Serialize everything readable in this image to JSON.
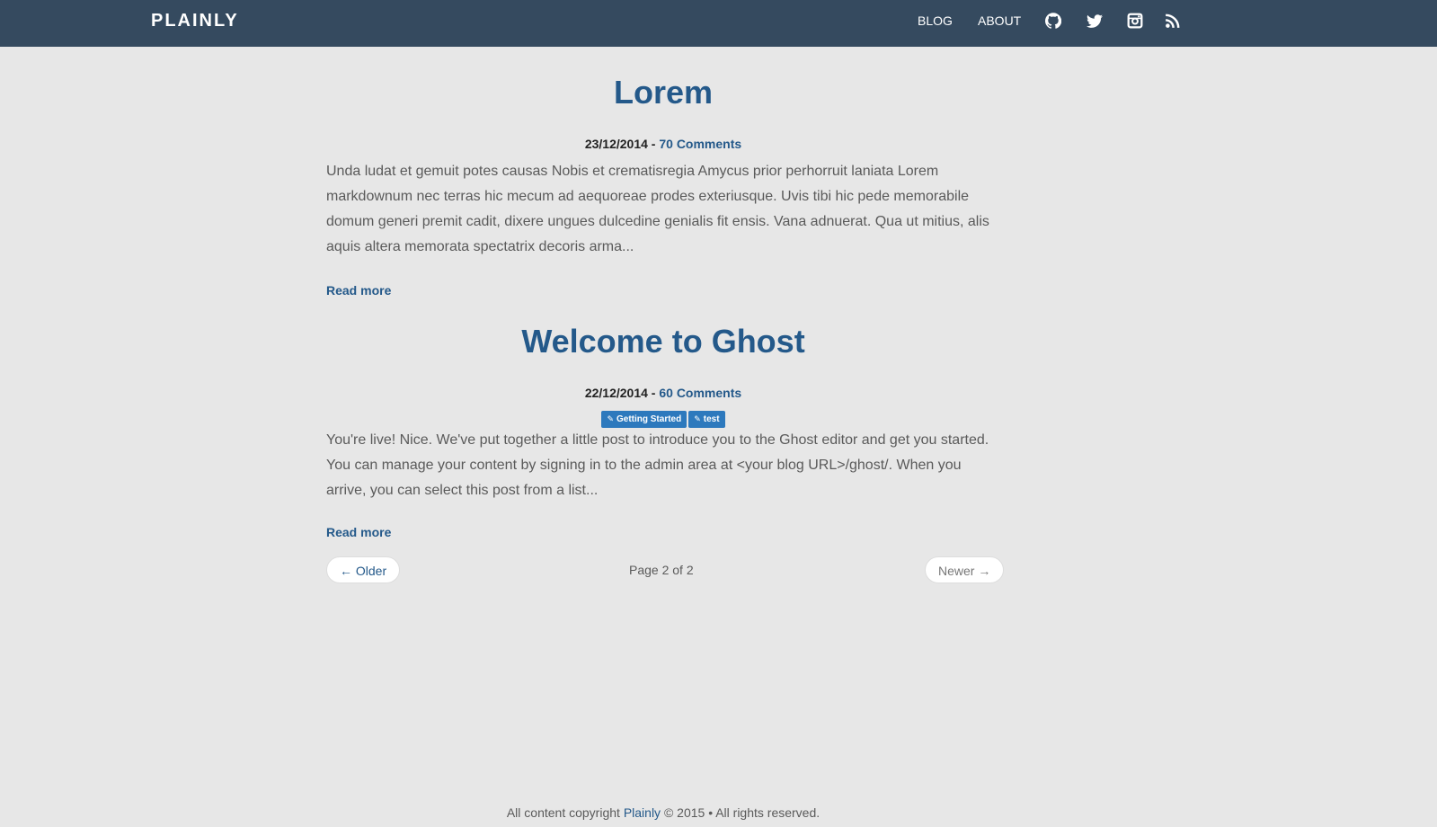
{
  "nav": {
    "brand": "PLAINLY",
    "links": [
      {
        "label": "BLOG"
      },
      {
        "label": "ABOUT"
      }
    ],
    "icons": [
      "github-icon",
      "twitter-icon",
      "instagram-icon",
      "rss-icon"
    ]
  },
  "posts": [
    {
      "title": "Lorem",
      "date": "23/12/2014",
      "separator": " - ",
      "comments": "70 Comments",
      "tags": [],
      "excerpt": "Unda ludat et gemuit potes causas Nobis et crematisregia Amycus prior perhorruit laniata Lorem markdownum nec terras hic mecum ad aequoreae prodes exteriusque. Uvis tibi hic pede memorabile domum generi premit cadit, dixere ungues dulcedine genialis fit ensis. Vana adnuerat. Qua ut mitius, alis aquis altera memorata spectatrix decoris arma...",
      "read_more": "Read more"
    },
    {
      "title": "Welcome to Ghost",
      "date": "22/12/2014",
      "separator": " - ",
      "comments": "60 Comments",
      "tags": [
        "Getting Started",
        "test"
      ],
      "excerpt": "You're live! Nice. We've put together a little post to introduce you to the Ghost editor and get you started. You can manage your content by signing in to the admin area at <your blog URL>/ghost/. When you arrive, you can select this post from a list...",
      "read_more": "Read more"
    }
  ],
  "pagination": {
    "older": "← Older",
    "page": "Page 2 of 2",
    "newer": "Newer →"
  },
  "footer": {
    "prefix": "All content copyright ",
    "link": "Plainly",
    "suffix": " © 2015 • All rights reserved."
  },
  "colors": {
    "navbar": "#354a5f",
    "background": "#e7e7e7",
    "accent": "#24598a",
    "tag": "#2d79bd"
  }
}
